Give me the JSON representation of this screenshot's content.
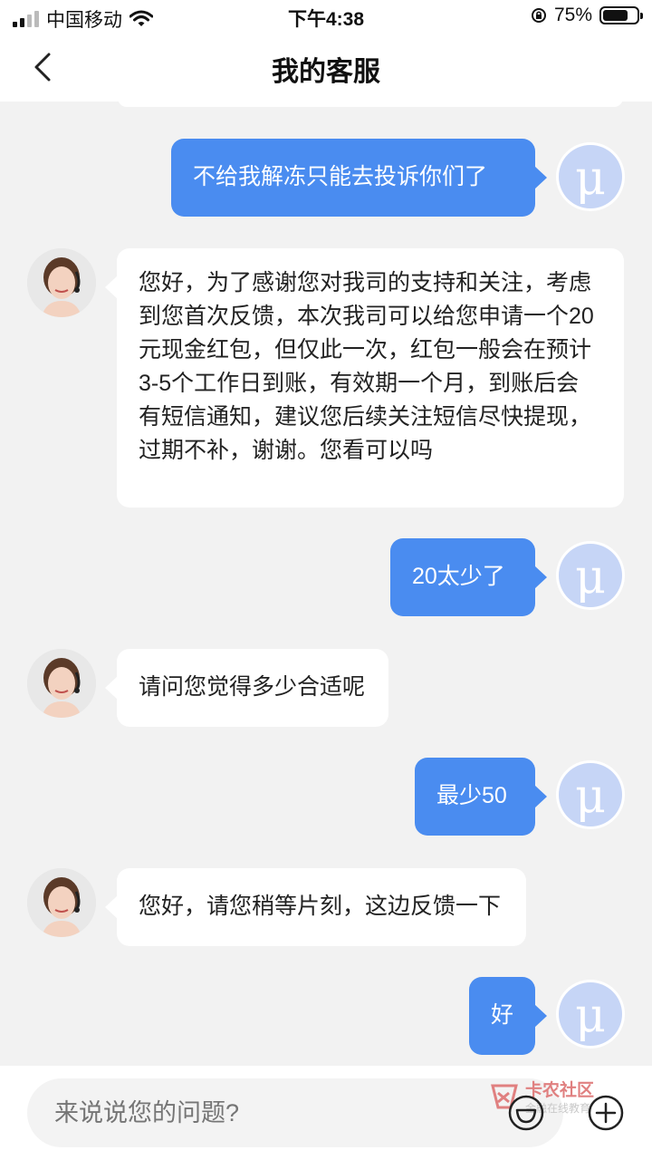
{
  "status_bar": {
    "carrier": "中国移动",
    "time": "下午4:38",
    "battery_percent": "75%",
    "battery_level": 0.75
  },
  "nav": {
    "back_icon": "chevron-left-icon",
    "title": "我的客服"
  },
  "messages": [
    {
      "sender": "user",
      "text": "不给我解冻只能去投诉你们了"
    },
    {
      "sender": "agent",
      "lines": [
        "您好，为了感谢您对我司的支持和关注，考虑",
        "到您首次反馈，本次我司可以给您申请一个20",
        "元现金红包，但仅此一次，红包一般会在预计",
        "3-5个工作日到账，有效期一个月，到账后会",
        "有短信通知，建议您后续关注短信尽快提现，",
        "过期不补，谢谢。您看可以吗"
      ]
    },
    {
      "sender": "user",
      "text": "20太少了"
    },
    {
      "sender": "agent",
      "text": "请问您觉得多少合适呢"
    },
    {
      "sender": "user",
      "text": "最少50"
    },
    {
      "sender": "agent",
      "text": "您好，请您稍等片刻，这边反馈一下"
    },
    {
      "sender": "user",
      "text": "好"
    }
  ],
  "user_avatar": {
    "glyph": "μ",
    "color": "#c6d5f6"
  },
  "input": {
    "placeholder": "来说说您的问题?"
  },
  "bottom_icons": [
    "emoji-icon",
    "plus-icon"
  ],
  "watermark": {
    "title": "卡农社区",
    "subtitle": "金融在线教育"
  },
  "colors": {
    "outgoing_bubble": "#4a8cf0",
    "incoming_bubble": "#ffffff",
    "background": "#f2f2f2"
  }
}
